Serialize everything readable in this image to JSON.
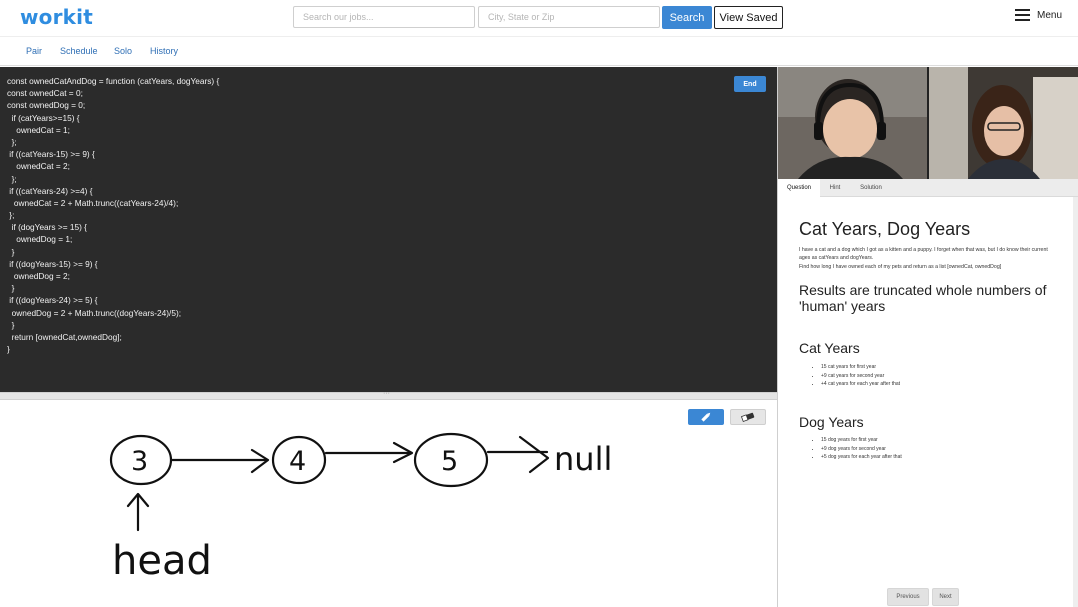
{
  "header": {
    "logo": "workit",
    "search_jobs_placeholder": "Search our jobs...",
    "location_placeholder": "City, State or Zip",
    "search_button": "Search",
    "view_saved_button": "View Saved",
    "menu_label": "Menu"
  },
  "subnav": {
    "items": [
      "Pair",
      "Schedule",
      "Solo",
      "History"
    ]
  },
  "editor": {
    "end_button": "End",
    "lines": [
      "const ownedCatAndDog = function (catYears, dogYears) {",
      "const ownedCat = 0;",
      "const ownedDog = 0;",
      "  if (catYears>=15) {",
      "    ownedCat = 1;",
      "  };",
      " if ((catYears-15) >= 9) {",
      "    ownedCat = 2;",
      "  };",
      " if ((catYears-24) >=4) {",
      "   ownedCat = 2 + Math.trunc((catYears-24)/4);",
      " };",
      "  if (dogYears >= 15) {",
      "    ownedDog = 1;",
      "  }",
      " if ((dogYears-15) >= 9) {",
      "   ownedDog = 2;",
      "  }",
      " if ((dogYears-24) >= 5) {",
      "  ownedDog = 2 + Math.trunc((dogYears-24)/5);",
      "  }",
      "  return [ownedCat,ownedDog];",
      "}"
    ]
  },
  "whiteboard": {
    "nodes": [
      "3",
      "4",
      "5"
    ],
    "terminal": "null",
    "pointer_label": "head"
  },
  "panel": {
    "tabs": [
      "Question",
      "Hint",
      "Solution"
    ],
    "active_tab": "Question",
    "title": "Cat Years, Dog Years",
    "intro_1": "I have a cat and a dog which I got as a kitten and a puppy. I forget when that was, but I do know their current ages as catYears and dogYears.",
    "intro_2": "Find how long I have owned each of my pets and return as a list [ownedCat, ownedDog]",
    "subtitle": "Results are truncated whole numbers of 'human' years",
    "cat_heading": "Cat Years",
    "cat_items": [
      "15 cat years for first year",
      "+9 cat years for second year",
      "+4 cat years for each year after that"
    ],
    "dog_heading": "Dog Years",
    "dog_items": [
      "15 dog years for first year",
      "+9 dog years for second year",
      "+5 dog years for each year after that"
    ],
    "previous_button": "Previous",
    "next_button": "Next"
  },
  "colors": {
    "accent": "#3b87d4",
    "logo": "#2f8de0",
    "editor_bg": "#2b2b2b"
  }
}
